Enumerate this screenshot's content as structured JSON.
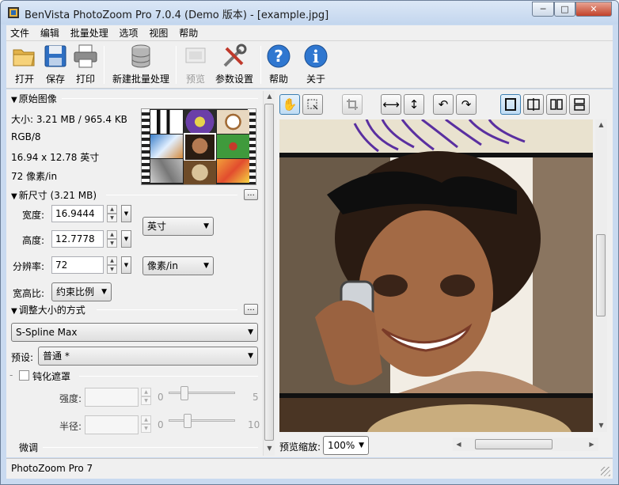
{
  "window": {
    "title": "BenVista PhotoZoom Pro 7.0.4 (Demo 版本) - [example.jpg]",
    "minimize": "─",
    "maximize": "□",
    "close": "✕"
  },
  "menu": [
    "文件",
    "编辑",
    "批量处理",
    "选项",
    "视图",
    "帮助"
  ],
  "toolbar": {
    "open": "打开",
    "save": "保存",
    "print": "打印",
    "new_batch": "新建批量处理",
    "preview": "预览",
    "params": "参数设置",
    "help": "帮助",
    "about": "关于"
  },
  "original": {
    "header": "原始图像",
    "size": "大小: 3.21 MB / 965.4 KB",
    "mode": "RGB/8",
    "dimensions": "16.94 x 12.78 英寸",
    "resolution": "72 像素/in"
  },
  "new_size": {
    "header": "新尺寸 (3.21 MB)",
    "more": "...",
    "width_label": "宽度:",
    "width_value": "16.9444",
    "height_label": "高度:",
    "height_value": "12.7778",
    "unit": "英寸",
    "resolution_label": "分辨率:",
    "resolution_value": "72",
    "resolution_unit": "像素/in",
    "aspect_label": "宽高比:",
    "aspect_value": "约束比例"
  },
  "resize": {
    "header": "调整大小的方式",
    "more": "...",
    "method": "S-Spline Max",
    "preset_label": "预设:",
    "preset_value": "普通 *",
    "unsharp_label": "钝化遮罩",
    "strength_label": "强度:",
    "strength_min": "0",
    "strength_max": "5",
    "radius_label": "半径:",
    "radius_min": "0",
    "radius_max": "10",
    "fine_tune": "微调"
  },
  "preview": {
    "zoom_label": "预览缩放:",
    "zoom_value": "100%"
  },
  "status": {
    "text": "PhotoZoom Pro 7"
  }
}
